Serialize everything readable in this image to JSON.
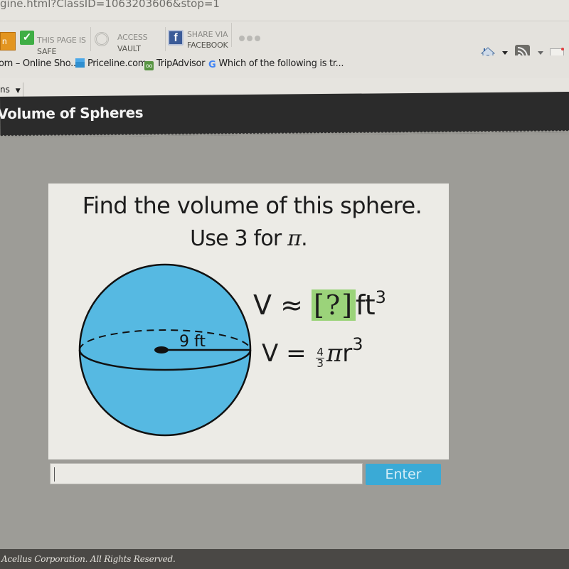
{
  "browser": {
    "address_text": "gine.html?ClassID=1063203606&stop=1",
    "toolbar": {
      "orange_tab_label": "n",
      "safe_line1": "THIS PAGE IS",
      "safe_line2": "SAFE",
      "vault_line1": "ACCESS",
      "vault_line2": "VAULT",
      "share_line1": "SHARE VIA",
      "share_line2": "FACEBOOK"
    },
    "bookmarks": [
      {
        "label": "om – Online Sho...",
        "icon": "none"
      },
      {
        "label": "Priceline.com",
        "icon": "priceline-icon"
      },
      {
        "label": "TripAdvisor",
        "icon": "tripadvisor-icon"
      },
      {
        "label": "Which of the following is tr...",
        "icon": "google-icon"
      }
    ],
    "menu_item": "ns"
  },
  "app": {
    "lesson_title": "Volume of Spheres"
  },
  "question": {
    "line1": "Find the volume of this sphere.",
    "line2_prefix": "Use 3 for ",
    "line2_symbol": "π",
    "line2_suffix": ".",
    "radius_label": "9 ft",
    "answer_lhs": "V ≈ ",
    "answer_placeholder": "[?]",
    "answer_unit": "ft",
    "answer_exponent": "3",
    "formula_lhs": "V = ",
    "formula_num": "4",
    "formula_den": "3",
    "formula_pi": "π",
    "formula_var": "r",
    "formula_exponent": "3"
  },
  "answer_form": {
    "input_value": "",
    "enter_label": "Enter"
  },
  "footer": {
    "copyright": "Acellus Corporation.  All Rights Reserved."
  },
  "colors": {
    "sphere_fill": "#56b9e2",
    "answer_highlight": "#9bd37a",
    "enter_button": "#3aaad6",
    "header_bg": "#2b2b2b"
  }
}
